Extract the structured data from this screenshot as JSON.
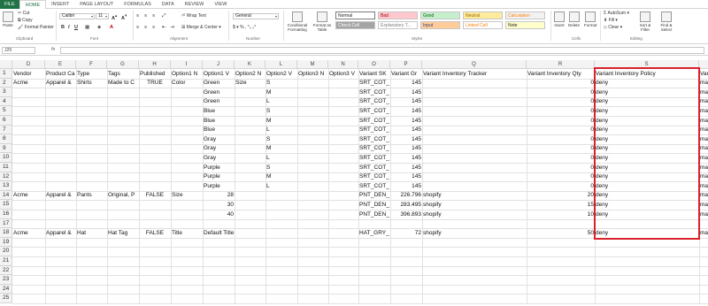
{
  "ribbon_tabs": [
    "FILE",
    "HOME",
    "INSERT",
    "PAGE LAYOUT",
    "FORMULAS",
    "DATA",
    "REVIEW",
    "VIEW"
  ],
  "ribbon": {
    "paste": "Paste",
    "cut": "Cut",
    "copy": "Copy",
    "format_painter": "Format Painter",
    "clipboard": "Clipboard",
    "font_name": "Calibri",
    "font_size": "11",
    "font": "Font",
    "wrap_text": "Wrap Text",
    "merge_center": "Merge & Center",
    "alignment": "Alignment",
    "number_format": "General",
    "number": "Number",
    "conditional_formatting": "Conditional Formatting",
    "format_as_table": "Format as Table",
    "styles": "Styles",
    "style_cells": [
      {
        "label": "Normal",
        "bg": "#ffffff",
        "fg": "#222222"
      },
      {
        "label": "Bad",
        "bg": "#ffc7ce",
        "fg": "#9c0006"
      },
      {
        "label": "Good",
        "bg": "#c6efce",
        "fg": "#006100"
      },
      {
        "label": "Neutral",
        "bg": "#ffeb9c",
        "fg": "#9c6500"
      },
      {
        "label": "Calculation",
        "bg": "#f2f2f2",
        "fg": "#fa7d00"
      },
      {
        "label": "Check Cell",
        "bg": "#a5a5a5",
        "fg": "#ffffff"
      },
      {
        "label": "Explanatory T...",
        "bg": "#ffffff",
        "fg": "#7f7f7f"
      },
      {
        "label": "Input",
        "bg": "#ffcc99",
        "fg": "#3f3f76"
      },
      {
        "label": "Linked Cell",
        "bg": "#ffffff",
        "fg": "#fa7d00"
      },
      {
        "label": "Note",
        "bg": "#ffffcc",
        "fg": "#222222"
      }
    ],
    "insert": "Insert",
    "delete": "Delete",
    "format": "Format",
    "cells": "Cells",
    "autosum": "AutoSum",
    "fill": "Fill",
    "clear": "Clear",
    "sort_filter": "Sort & Filter",
    "find_select": "Find & Select",
    "editing": "Editing"
  },
  "formula_bar": {
    "name_box": "J29",
    "fx": "fx",
    "value": ""
  },
  "columns": [
    "D",
    "E",
    "F",
    "G",
    "H",
    "I",
    "J",
    "K",
    "L",
    "M",
    "N",
    "O",
    "P",
    "Q",
    "R",
    "S",
    "T"
  ],
  "rows": [
    [
      "Vendor",
      "Product Ca",
      "Type",
      "Tags",
      "Published",
      "Option1 N",
      "Option1 V",
      "Option2 N",
      "Option2 V",
      "Option3 N",
      "Option3 V",
      "Variant SK",
      "Variant Gr",
      "Variant Inventory Tracker",
      "Variant Inventory Qty",
      "Variant Inventory Policy",
      "Variant Fu"
    ],
    [
      "Acme",
      "Apparel &",
      "Shirts",
      "Made to C",
      "TRUE",
      "Color",
      "Green",
      "Size",
      "S",
      "",
      "",
      "SRT_COT_",
      "145",
      "",
      "0",
      "deny",
      "manual"
    ],
    [
      "",
      "",
      "",
      "",
      "",
      "",
      "Green",
      "",
      "M",
      "",
      "",
      "SRT_COT_",
      "145",
      "",
      "0",
      "deny",
      "manual"
    ],
    [
      "",
      "",
      "",
      "",
      "",
      "",
      "Green",
      "",
      "L",
      "",
      "",
      "SRT_COT_",
      "145",
      "",
      "0",
      "deny",
      "manual"
    ],
    [
      "",
      "",
      "",
      "",
      "",
      "",
      "Blue",
      "",
      "S",
      "",
      "",
      "SRT_COT_",
      "145",
      "",
      "0",
      "deny",
      "manual"
    ],
    [
      "",
      "",
      "",
      "",
      "",
      "",
      "Blue",
      "",
      "M",
      "",
      "",
      "SRT_COT_",
      "145",
      "",
      "0",
      "deny",
      "manual"
    ],
    [
      "",
      "",
      "",
      "",
      "",
      "",
      "Blue",
      "",
      "L",
      "",
      "",
      "SRT_COT_",
      "145",
      "",
      "0",
      "deny",
      "manual"
    ],
    [
      "",
      "",
      "",
      "",
      "",
      "",
      "Gray",
      "",
      "S",
      "",
      "",
      "SRT_COT_",
      "145",
      "",
      "0",
      "deny",
      "manual"
    ],
    [
      "",
      "",
      "",
      "",
      "",
      "",
      "Gray",
      "",
      "M",
      "",
      "",
      "SRT_COT_",
      "145",
      "",
      "0",
      "deny",
      "manual"
    ],
    [
      "",
      "",
      "",
      "",
      "",
      "",
      "Gray",
      "",
      "L",
      "",
      "",
      "SRT_COT_",
      "145",
      "",
      "0",
      "deny",
      "manual"
    ],
    [
      "",
      "",
      "",
      "",
      "",
      "",
      "Purple",
      "",
      "S",
      "",
      "",
      "SRT_COT_",
      "145",
      "",
      "0",
      "deny",
      "manual"
    ],
    [
      "",
      "",
      "",
      "",
      "",
      "",
      "Purple",
      "",
      "M",
      "",
      "",
      "SRT_COT_",
      "145",
      "",
      "0",
      "deny",
      "manual"
    ],
    [
      "",
      "",
      "",
      "",
      "",
      "",
      "Purple",
      "",
      "L",
      "",
      "",
      "SRT_COT_",
      "145",
      "",
      "0",
      "deny",
      "manual"
    ],
    [
      "Acme",
      "Apparel &",
      "Pants",
      "Original, P",
      "FALSE",
      "Size",
      "28",
      "",
      "",
      "",
      "",
      "PNT_DEN_",
      "226.796",
      "shopify",
      "20",
      "deny",
      "manual"
    ],
    [
      "",
      "",
      "",
      "",
      "",
      "",
      "30",
      "",
      "",
      "",
      "",
      "PNT_DEN_",
      "283.495",
      "shopify",
      "15",
      "deny",
      "manual"
    ],
    [
      "",
      "",
      "",
      "",
      "",
      "",
      "40",
      "",
      "",
      "",
      "",
      "PNT_DEN_",
      "396.893",
      "shopify",
      "10",
      "deny",
      "manual"
    ],
    [
      "",
      "",
      "",
      "",
      "",
      "",
      "",
      "",
      "",
      "",
      "",
      "",
      "",
      "",
      "",
      "",
      ""
    ],
    [
      "Acme",
      "Apparel &",
      "Hat",
      "Hat Tag",
      "FALSE",
      "Title",
      "Default Title",
      "",
      "",
      "",
      "",
      "HAT_GRY_",
      "72",
      "shopify",
      "50",
      "deny",
      "manual"
    ],
    [
      "",
      "",
      "",
      "",
      "",
      "",
      "",
      "",
      "",
      "",
      "",
      "",
      "",
      "",
      "",
      "",
      ""
    ],
    [
      "",
      "",
      "",
      "",
      "",
      "",
      "",
      "",
      "",
      "",
      "",
      "",
      "",
      "",
      "",
      "",
      ""
    ],
    [
      "",
      "",
      "",
      "",
      "",
      "",
      "",
      "",
      "",
      "",
      "",
      "",
      "",
      "",
      "",
      "",
      ""
    ],
    [
      "",
      "",
      "",
      "",
      "",
      "",
      "",
      "",
      "",
      "",
      "",
      "",
      "",
      "",
      "",
      "",
      ""
    ],
    [
      "",
      "",
      "",
      "",
      "",
      "",
      "",
      "",
      "",
      "",
      "",
      "",
      "",
      "",
      "",
      "",
      ""
    ],
    [
      "",
      "",
      "",
      "",
      "",
      "",
      "",
      "",
      "",
      "",
      "",
      "",
      "",
      "",
      "",
      "",
      ""
    ],
    [
      "",
      "",
      "",
      "",
      "",
      "",
      "",
      "",
      "",
      "",
      "",
      "",
      "",
      "",
      "",
      "",
      ""
    ]
  ],
  "row_numbers": [
    "1",
    "2",
    "3",
    "4",
    "5",
    "6",
    "7",
    "8",
    "9",
    "10",
    "11",
    "12",
    "13",
    "14",
    "15",
    "16",
    "17",
    "18",
    "19",
    "20",
    "21",
    "22",
    "23",
    "24",
    "25"
  ],
  "highlight_color": "#d9222a",
  "accent_color": "#217346"
}
